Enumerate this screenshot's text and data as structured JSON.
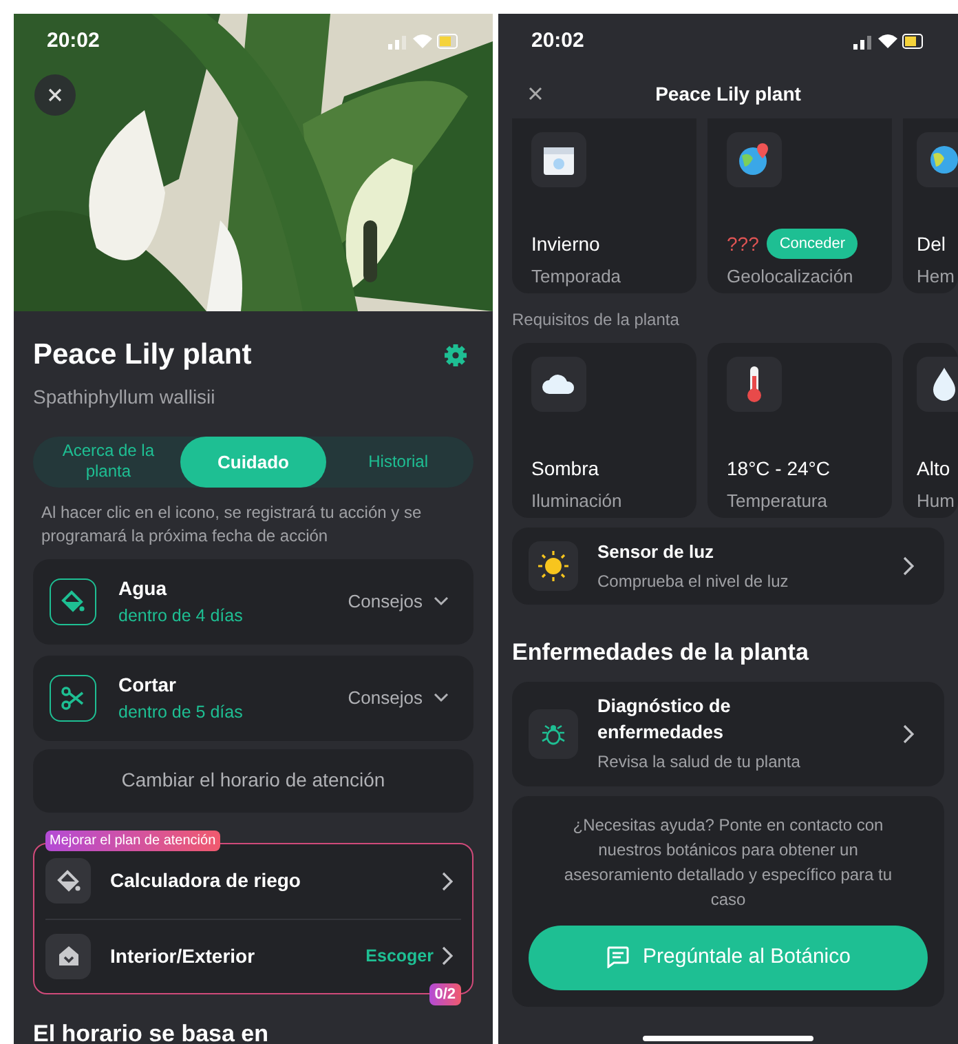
{
  "left": {
    "status": {
      "time": "20:02"
    },
    "title": "Peace Lily plant",
    "subtitle": "Spathiphyllum wallisii",
    "tabs": [
      {
        "label": "Acerca de la planta",
        "selected": false
      },
      {
        "label": "Cuidado",
        "selected": true
      },
      {
        "label": "Historial",
        "selected": false
      }
    ],
    "hint": "Al hacer clic en el icono, se registrará tu acción y se programará la próxima fecha de acción",
    "tasks": [
      {
        "kind": "water",
        "title": "Agua",
        "due": "dentro de 4 días",
        "tips": "Consejos"
      },
      {
        "kind": "cut",
        "title": "Cortar",
        "due": "dentro de 5 días",
        "tips": "Consejos"
      }
    ],
    "schedule_button": "Cambiar el horario de atención",
    "upgrade": {
      "badge": "Mejorar el plan de atención",
      "items": [
        {
          "kind": "water",
          "label": "Calculadora de riego"
        },
        {
          "kind": "house",
          "label": "Interior/Exterior",
          "action": "Escoger"
        }
      ],
      "counter": "0/2"
    },
    "section_heading": "El horario se basa en"
  },
  "right": {
    "status": {
      "time": "20:02"
    },
    "header": {
      "title": "Peace Lily plant"
    },
    "conditions": [
      {
        "kind": "calendar",
        "value": "Invierno",
        "label": "Temporada"
      },
      {
        "kind": "geo",
        "value": "???",
        "action": "Conceder",
        "label": "Geolocalización"
      },
      {
        "kind": "globe",
        "value": "Del",
        "label": "Hem"
      }
    ],
    "requirements_label": "Requisitos de la planta",
    "requirements": [
      {
        "kind": "cloud",
        "value": "Sombra",
        "label": "Iluminación"
      },
      {
        "kind": "thermometer",
        "value": "18°C - 24°C",
        "label": "Temperatura"
      },
      {
        "kind": "drop",
        "value": "Alto",
        "label": "Hum"
      }
    ],
    "light_sensor": {
      "title": "Sensor de luz",
      "subtitle": "Comprueba el nivel de luz"
    },
    "diseases_heading": "Enfermedades de la planta",
    "diagnosis": {
      "title": "Diagnóstico de enfermedades",
      "subtitle": "Revisa la salud de tu planta"
    },
    "help": {
      "text": "¿Necesitas ayuda? Ponte en contacto con nuestros botánicos para obtener un asesoramiento detallado y específico para tu caso",
      "button": "Pregúntale al Botánico"
    }
  }
}
